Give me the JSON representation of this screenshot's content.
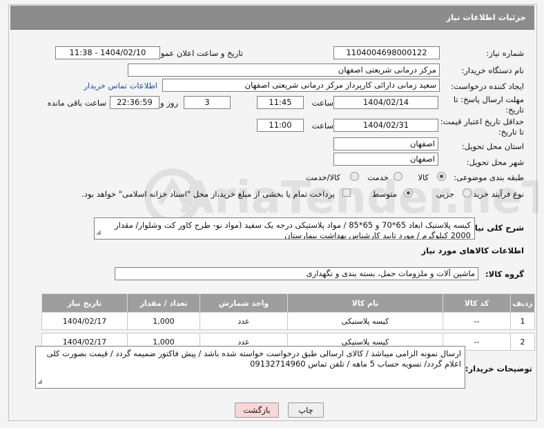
{
  "header": {
    "title": "جزئیات اطلاعات نیاز"
  },
  "form": {
    "need_number_label": "شماره نیاز:",
    "need_number": "1104004698000122",
    "announce_datetime_label": "تاریخ و ساعت اعلان عمومی:",
    "announce_datetime": "1404/02/10 - 11:38",
    "buyer_org_label": "نام دستگاه خریدار:",
    "buyer_org": "مرکز درمانی شریعتی اصفهان",
    "creator_label": "ایجاد کننده درخواست:",
    "creator": "سعید زمانی دارائی کارپرداز مرکز درمانی شریعتی اصفهان",
    "contact_link": "اطلاعات تماس خریدار",
    "deadline_label_1": "مهلت ارسال پاسخ: تا",
    "deadline_label_2": "تاریخ:",
    "deadline_date": "1404/02/14",
    "time_label": "ساعت",
    "deadline_time": "11:45",
    "days_value": "3",
    "days_label": "روز و",
    "remaining_time": "22:36:59",
    "remaining_label": "ساعت باقی مانده",
    "validity_label_1": "حداقل تاریخ اعتبار قیمت:",
    "validity_label_2": "تا تاریخ:",
    "validity_date": "1404/02/31",
    "validity_time_label": "ساعت",
    "validity_time": "11:00",
    "province_label": "استان محل تحویل:",
    "province": "اصفهان",
    "city_label": "شهر محل تحویل:",
    "city": "اصفهان",
    "category_label": "طبقه بندی موضوعی:",
    "category_options": [
      "کالا",
      "خدمت",
      "کالا/خدمت"
    ],
    "category_selected": "کالا",
    "process_label": "نوع فرآیند خرید :",
    "process_options": [
      "جزیی",
      "متوسط"
    ],
    "process_selected": "متوسط",
    "treasury_note": "پرداخت تمام یا بخشی از مبلغ خرید،از محل \"اسناد خزانه اسلامی\" خواهد بود.",
    "description_label": "شرح کلی نیاز:",
    "description": "کیسه پلاستیک ابعاد 65*70 و 65*85  / مواد پلاستیکی درجه یک سفید (مواد نو- طرح کاور کت وشلوار/ مقدار 2000 کیلوگرم / مورد تایید کارشناس بهداشت بیمارستان",
    "goods_info_title": "اطلاعات کالاهای مورد نیاز",
    "goods_group_label": "گروه کالا:",
    "goods_group": "ماشین آلات و ملزومات حمل، بسته بندی و نگهداری",
    "buyer_notes_label": "توضیحات خریدار:",
    "buyer_notes": "ارسال نمونه الزامی میباشد / کالای ارسالی طبق درخواست خواسته شده باشد / پیش فاکتور ضمیمه گردد / قیمت بصورت کلی اعلام گردد/ تسویه حساب 5 ماهه / تلفن تماس 09132714960"
  },
  "table": {
    "columns": [
      "ردیف",
      "کد کالا",
      "نام کالا",
      "واحد شمارش",
      "تعداد / مقدار",
      "تاریخ نیاز"
    ],
    "rows": [
      [
        "1",
        "--",
        "کیسه پلاستیکی",
        "عدد",
        "1,000",
        "1404/02/17"
      ],
      [
        "2",
        "--",
        "کیسه پلاستیکی",
        "عدد",
        "1,000",
        "1404/02/17"
      ]
    ]
  },
  "buttons": {
    "print": "چاپ",
    "back": "بازگشت"
  },
  "watermark": {
    "text": "AriaTender.neT"
  },
  "colors": {
    "header_bg": "#8c8c8c",
    "table_header_bg": "#9e9e9e",
    "link": "#1a4fa0",
    "back_button_bg": "#f8d7d7"
  }
}
